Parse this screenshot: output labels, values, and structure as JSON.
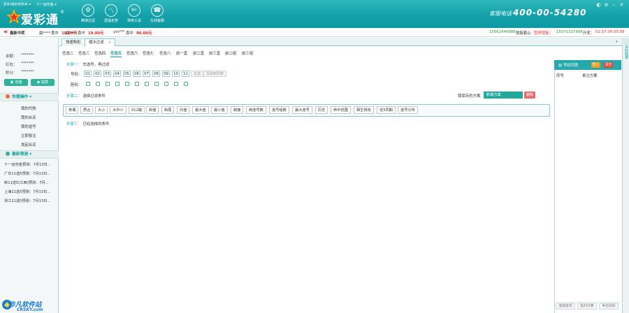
{
  "app": {
    "topline": [
      "爱彩通中奖助手 ▾",
      "十一运夺金 ▾"
    ],
    "logo_text": "爱彩通",
    "logo_mark": "®",
    "nav": [
      {
        "label": "精准过滤",
        "icon": "filter-icon",
        "glyph": "⚙"
      },
      {
        "label": "遗漏走势",
        "icon": "trend-chart-icon",
        "glyph": "〽"
      },
      {
        "label": "常用工具",
        "icon": "tools-icon",
        "glyph": "✄"
      },
      {
        "label": "在线客服",
        "icon": "headset-icon",
        "glyph": "☎"
      }
    ],
    "hotline_label": "客服电话",
    "hotline_number": "400-00-54280"
  },
  "ticker": {
    "label": "最新中奖",
    "items": [
      {
        "user": "晨****",
        "hit": "喜中",
        "amount": "18.00元"
      },
      {
        "user": "晨****",
        "hit": "喜中",
        "amount": "19.00元"
      },
      {
        "user": "yin***",
        "hit": "喜中",
        "amount": "90.00元"
      }
    ],
    "phone1": "15062446888",
    "sale_label": "销售截止:",
    "sale_status": "暂停销售！",
    "phone2": "15071337898",
    "open_label": "开奖：",
    "open_time": "01:07:06:05:08"
  },
  "sidebar": {
    "greeting": "你好，江福强jzq",
    "account": [
      {
        "label": "余额：",
        "value": "*******"
      },
      {
        "label": "红包：",
        "value": "*******"
      },
      {
        "label": "积分：",
        "value": "*******"
      }
    ],
    "recharge": "充值",
    "withdraw": "提款",
    "quick_title": "快捷操作",
    "quick_links": [
      "我的代购",
      "我的合买",
      "我的追号",
      "立即投注",
      "发起合买"
    ],
    "predict_title": "最新预测",
    "predictions": [
      "十一运夺金预测：7月13日...",
      "广东11选5预测：7月13日...",
      "新11选5(江西)预测：7月...",
      "上海11选5预测：7月13日...",
      "浙江11选5预测：7月13日..."
    ],
    "watermark_cn": "非凡软件站",
    "watermark_en": "CRSKY.com"
  },
  "tabs": [
    {
      "label": "快速购彩",
      "active": false
    },
    {
      "label": "缩水过滤",
      "active": true,
      "close": "×"
    }
  ],
  "play_types": [
    "任选二",
    "任选三",
    "任选四",
    "任选五",
    "任选六",
    "任选七",
    "任选八",
    "前一直",
    "前二直",
    "前三直",
    "前二组",
    "前三组"
  ],
  "active_play_index": 3,
  "step1": {
    "label": "步骤一：",
    "pre": "先选号，再过滤",
    "number_label": "号码：",
    "numbers": [
      "01",
      "02",
      "03",
      "04",
      "05",
      "06",
      "07",
      "08",
      "09",
      "10",
      "11"
    ],
    "select_all": "全选",
    "add_to_list": "添加到列表",
    "dan_label": "胆码："
  },
  "step2": {
    "label": "步骤二：",
    "text": "选择过滤条件",
    "saved_label": "我保存的方案",
    "plan_value": "新建方案",
    "delete": "删除"
  },
  "filters": [
    "奇偶",
    "质合",
    "大小",
    "大中小",
    "012路",
    "和值",
    "和尾",
    "均值",
    "最大值",
    "最小值",
    "跨度",
    "两连号数",
    "连号组数",
    "最大连号",
    "历史",
    "命中范围",
    "相生相克",
    "任5同期",
    "连号分布"
  ],
  "step3": {
    "label": "步骤三：",
    "text": "已经选择的条件"
  },
  "right_panel": {
    "strip_label": "当前结果",
    "title": "号码列表",
    "import": "导入",
    "clear": "清空",
    "col_seq": "序号",
    "col_plan": "单注方案",
    "footer": [
      "遗漏查询",
      "盈利计算",
      "导出号码"
    ]
  },
  "colors": {
    "header": "#14a1a9",
    "accent": "#13a39c",
    "red": "#e03434",
    "orange": "#f39a1e"
  }
}
